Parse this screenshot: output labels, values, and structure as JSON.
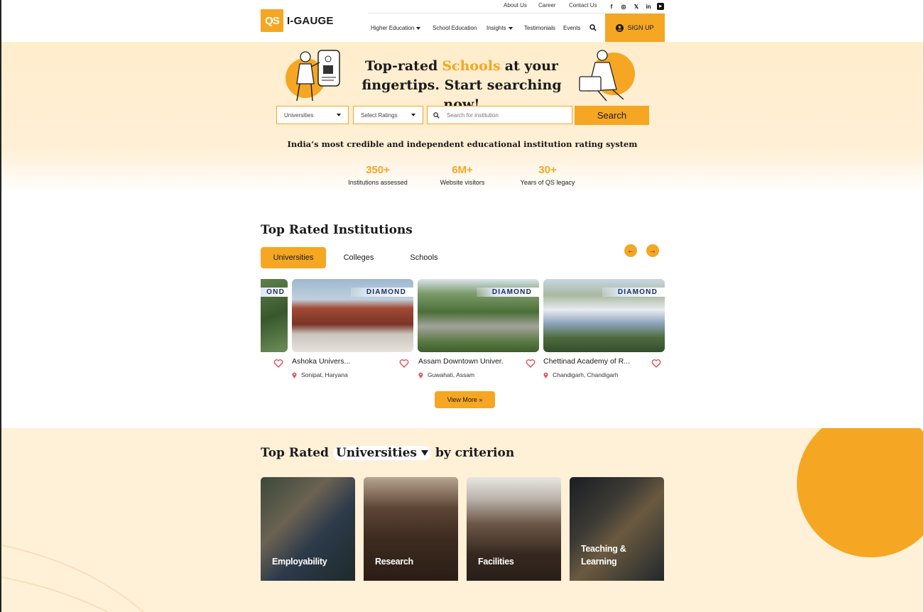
{
  "brand": {
    "logo_mark": "QS",
    "logo_text": "I-GAUGE"
  },
  "topbar": {
    "links": [
      "About Us",
      "Career",
      "Contact Us"
    ],
    "socials": [
      "f",
      "◎",
      "𝕏",
      "in",
      "▶"
    ]
  },
  "nav": {
    "items": [
      "Higher Education",
      "School Education",
      "Insights",
      "Testimonials",
      "Events"
    ],
    "signup": "SIGN UP"
  },
  "hero": {
    "title_part1": "Top-rated",
    "title_highlight": "Schools",
    "title_part2": "at your",
    "title_line2": "fingertips. Start searching now!",
    "filters": {
      "type": "Universities",
      "ratings": "Select Ratings"
    },
    "search_placeholder": "Search for institution",
    "search_button": "Search",
    "tagline": "India’s most credible and independent educational institution rating system",
    "stats": [
      {
        "value": "350+",
        "label": "Institutions assessed"
      },
      {
        "value": "6M+",
        "label": "Website visitors"
      },
      {
        "value": "30+",
        "label": "Years of QS legacy"
      }
    ]
  },
  "top_rated": {
    "title": "Top Rated Institutions",
    "tabs": [
      "Universities",
      "Colleges",
      "Schools"
    ],
    "arrows": [
      "←",
      "→"
    ],
    "partial_badge": "OND",
    "cards": [
      {
        "badge": "DIAMOND",
        "name": "Ashoka Univers...",
        "location": "Sonipat, Haryana"
      },
      {
        "badge": "DIAMOND",
        "name": "Assam Downtown Univer...",
        "location": "Guwahati, Assam"
      },
      {
        "badge": "DIAMOND",
        "name": "Chettinad Academy of R...",
        "location": "Chandigarh, Chandigarh"
      }
    ],
    "view_more": "View More »"
  },
  "criterion": {
    "title_part1": "Top Rated",
    "selector": "Universities",
    "title_part2": "by criterion",
    "cards": [
      {
        "label": "Employability"
      },
      {
        "label": "Research"
      },
      {
        "label": "Facilities"
      },
      {
        "label": "Teaching & Learning"
      }
    ]
  },
  "colors": {
    "accent": "#f5a623",
    "hero_bg": "#ffedcc",
    "badge_text": "#1c2d5c"
  }
}
